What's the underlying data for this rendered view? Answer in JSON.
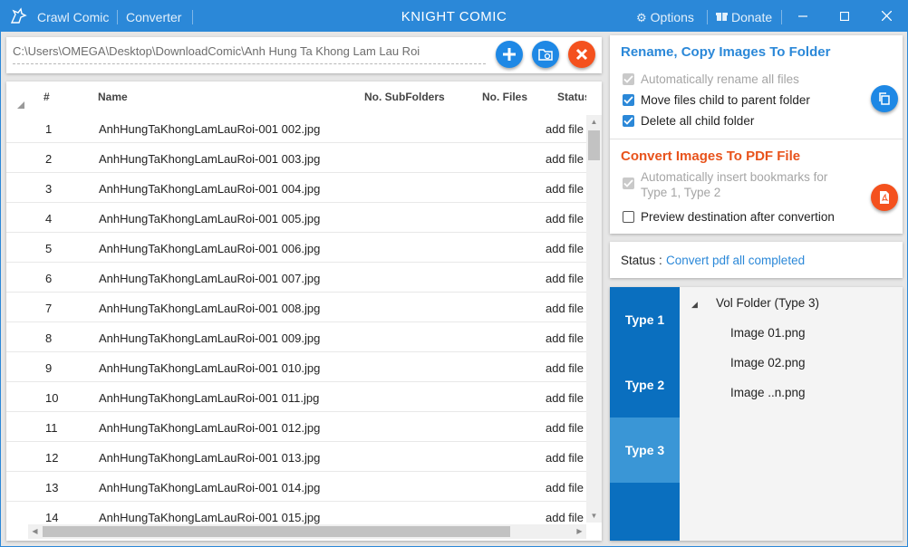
{
  "titlebar": {
    "menu": [
      "Crawl Comic",
      "Converter"
    ],
    "title": "KNIGHT COMIC",
    "options_label": "Options",
    "donate_label": "Donate"
  },
  "path": {
    "value": "C:\\Users\\OMEGA\\Desktop\\DownloadComic\\Anh Hung  Ta Khong Lam Lau Roi"
  },
  "table": {
    "headers": {
      "num": "#",
      "name": "Name",
      "subfolders": "No. SubFolders",
      "files": "No. Files",
      "status": "Status"
    },
    "rows": [
      {
        "num": "1",
        "name": "AnhHungTaKhongLamLauRoi-001 002.jpg",
        "status": "add file"
      },
      {
        "num": "2",
        "name": "AnhHungTaKhongLamLauRoi-001 003.jpg",
        "status": "add file"
      },
      {
        "num": "3",
        "name": "AnhHungTaKhongLamLauRoi-001 004.jpg",
        "status": "add file"
      },
      {
        "num": "4",
        "name": "AnhHungTaKhongLamLauRoi-001 005.jpg",
        "status": "add file"
      },
      {
        "num": "5",
        "name": "AnhHungTaKhongLamLauRoi-001 006.jpg",
        "status": "add file"
      },
      {
        "num": "6",
        "name": "AnhHungTaKhongLamLauRoi-001 007.jpg",
        "status": "add file"
      },
      {
        "num": "7",
        "name": "AnhHungTaKhongLamLauRoi-001 008.jpg",
        "status": "add file"
      },
      {
        "num": "8",
        "name": "AnhHungTaKhongLamLauRoi-001 009.jpg",
        "status": "add file"
      },
      {
        "num": "9",
        "name": "AnhHungTaKhongLamLauRoi-001 010.jpg",
        "status": "add file"
      },
      {
        "num": "10",
        "name": "AnhHungTaKhongLamLauRoi-001 011.jpg",
        "status": "add file"
      },
      {
        "num": "11",
        "name": "AnhHungTaKhongLamLauRoi-001 012.jpg",
        "status": "add file"
      },
      {
        "num": "12",
        "name": "AnhHungTaKhongLamLauRoi-001 013.jpg",
        "status": "add file"
      },
      {
        "num": "13",
        "name": "AnhHungTaKhongLamLauRoi-001 014.jpg",
        "status": "add file"
      },
      {
        "num": "14",
        "name": "AnhHungTaKhongLamLauRoi-001 015.jpg",
        "status": "add file"
      }
    ]
  },
  "rename": {
    "title": "Rename, Copy Images To Folder",
    "options": [
      {
        "label": "Automatically rename all files",
        "checked": true,
        "disabled": true
      },
      {
        "label": "Move files child to parent folder",
        "checked": true,
        "disabled": false
      },
      {
        "label": "Delete all child folder",
        "checked": true,
        "disabled": false
      }
    ]
  },
  "pdf": {
    "title": "Convert Images To PDF File",
    "options": [
      {
        "label_line1": "Automatically insert bookmarks for",
        "label_line2": "Type 1, Type 2",
        "checked": true,
        "disabled": true
      },
      {
        "label": "Preview destination after convertion",
        "checked": false,
        "disabled": false
      }
    ]
  },
  "status": {
    "label": "Status :",
    "value": "Convert pdf all completed"
  },
  "types": {
    "tabs": [
      "Type 1",
      "Type 2",
      "Type 3"
    ],
    "active": "Type 3",
    "tree": {
      "root": "Vol Folder (Type 3)",
      "children": [
        "Image 01.png",
        "Image 02.png",
        "Image ..n.png"
      ]
    }
  },
  "colors": {
    "accent": "#2b88d8",
    "pdf_title": "#e8531c",
    "fab_blue": "#1e88e5",
    "fab_red": "#f4511e",
    "tab_bg": "#0a6fbf",
    "tab_active": "#3a96d6"
  },
  "icons": {
    "logo": "knight-logo-icon",
    "options": "gear-icon",
    "donate": "gift-icon",
    "add": "plus-icon",
    "refresh_folder": "folder-refresh-icon",
    "clear": "close-icon",
    "copy": "copy-icon",
    "pdf": "pdf-icon"
  }
}
